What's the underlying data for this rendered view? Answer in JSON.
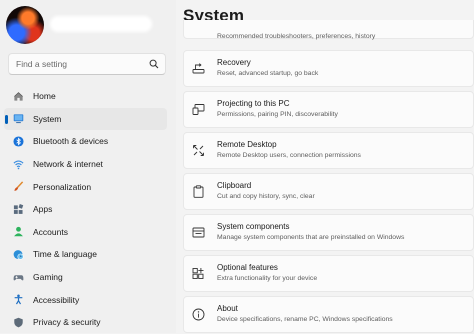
{
  "account": {
    "avatar_icon": "user-avatar"
  },
  "search": {
    "placeholder": "Find a setting",
    "icon": "search-icon"
  },
  "sidebar": {
    "items": [
      {
        "label": "Home",
        "icon": "home-icon",
        "active": false
      },
      {
        "label": "System",
        "icon": "system-icon",
        "active": true
      },
      {
        "label": "Bluetooth & devices",
        "icon": "bluetooth-icon",
        "active": false
      },
      {
        "label": "Network & internet",
        "icon": "network-icon",
        "active": false
      },
      {
        "label": "Personalization",
        "icon": "brush-icon",
        "active": false
      },
      {
        "label": "Apps",
        "icon": "apps-icon",
        "active": false
      },
      {
        "label": "Accounts",
        "icon": "accounts-icon",
        "active": false
      },
      {
        "label": "Time & language",
        "icon": "globe-clock-icon",
        "active": false
      },
      {
        "label": "Gaming",
        "icon": "gamepad-icon",
        "active": false
      },
      {
        "label": "Accessibility",
        "icon": "accessibility-icon",
        "active": false
      },
      {
        "label": "Privacy & security",
        "icon": "shield-icon",
        "active": false
      }
    ]
  },
  "page": {
    "title": "System"
  },
  "main": {
    "partial_desc": "Recommended troubleshooters, preferences, history",
    "cards": [
      {
        "title": "Recovery",
        "desc": "Reset, advanced startup, go back",
        "icon": "recovery-drive-icon"
      },
      {
        "title": "Projecting to this PC",
        "desc": "Permissions, pairing PIN, discoverability",
        "icon": "projecting-icon"
      },
      {
        "title": "Remote Desktop",
        "desc": "Remote Desktop users, connection permissions",
        "icon": "remote-desktop-icon"
      },
      {
        "title": "Clipboard",
        "desc": "Cut and copy history, sync, clear",
        "icon": "clipboard-icon"
      },
      {
        "title": "System components",
        "desc": "Manage system components that are preinstalled on Windows",
        "icon": "system-components-icon"
      },
      {
        "title": "Optional features",
        "desc": "Extra functionality for your device",
        "icon": "optional-features-icon"
      },
      {
        "title": "About",
        "desc": "Device specifications, rename PC, Windows specifications",
        "icon": "info-icon"
      }
    ]
  },
  "colors": {
    "accent": "#005fb8",
    "background": "#f3f3f3",
    "card": "#fbfbfb"
  }
}
